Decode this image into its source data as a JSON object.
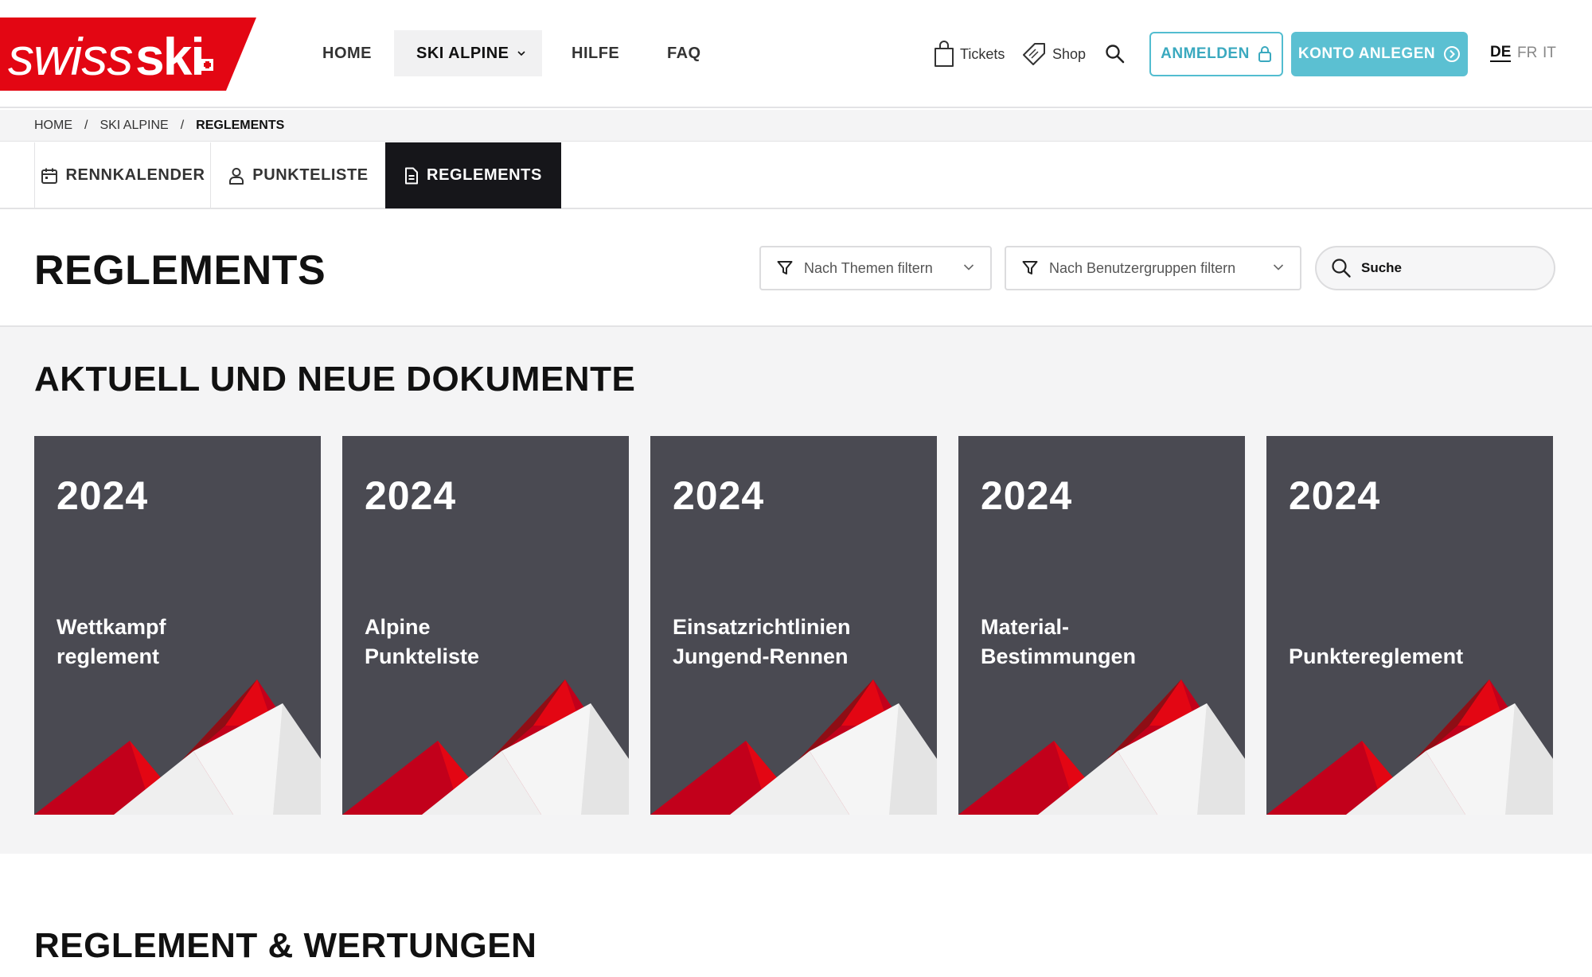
{
  "brand": {
    "logo_text": "swissski",
    "logo_color": "#e30613"
  },
  "nav": {
    "items": [
      {
        "label": "HOME"
      },
      {
        "label": "SKI ALPINE"
      },
      {
        "label": "HILFE"
      },
      {
        "label": "FAQ"
      }
    ]
  },
  "utilities": {
    "tickets": "Tickets",
    "shop": "Shop"
  },
  "auth": {
    "login": "ANMELDEN",
    "register": "KONTO ANLEGEN"
  },
  "languages": [
    {
      "code": "DE",
      "active": true
    },
    {
      "code": "FR"
    },
    {
      "code": "IT"
    }
  ],
  "breadcrumb": [
    "HOME",
    "SKI ALPINE",
    "REGLEMENTS"
  ],
  "tabs": [
    {
      "label": "RENNKALENDER",
      "icon": "calendar-icon"
    },
    {
      "label": "PUNKTELISTE",
      "icon": "user-icon"
    },
    {
      "label": "REGLEMENTS",
      "icon": "document-icon",
      "active": true
    }
  ],
  "page": {
    "title": "REGLEMENTS",
    "filter_themen": "Nach Themen filtern",
    "filter_gruppen": "Nach Benutzergruppen filtern",
    "search_placeholder": "Suche"
  },
  "current_docs": {
    "heading": "AKTUELL UND NEUE DOKUMENTE",
    "cards": [
      {
        "year": "2024",
        "line1": "Wettkampf",
        "line2": "reglement"
      },
      {
        "year": "2024",
        "line1": "Alpine",
        "line2": "Punkteliste"
      },
      {
        "year": "2024",
        "line1": "Einsatzrichtlinien",
        "line2": "Jungend-Rennen"
      },
      {
        "year": "2024",
        "line1": "Material-",
        "line2": "Bestimmungen"
      },
      {
        "year": "2024",
        "line1": "",
        "line2": "Punktereglement"
      }
    ]
  },
  "section2": {
    "heading": "REGLEMENT & WERTUNGEN"
  },
  "colors": {
    "accent": "#5bc0d2",
    "card_bg": "#4a4a52",
    "red": "#e30613",
    "dark_tab": "#16161a"
  }
}
